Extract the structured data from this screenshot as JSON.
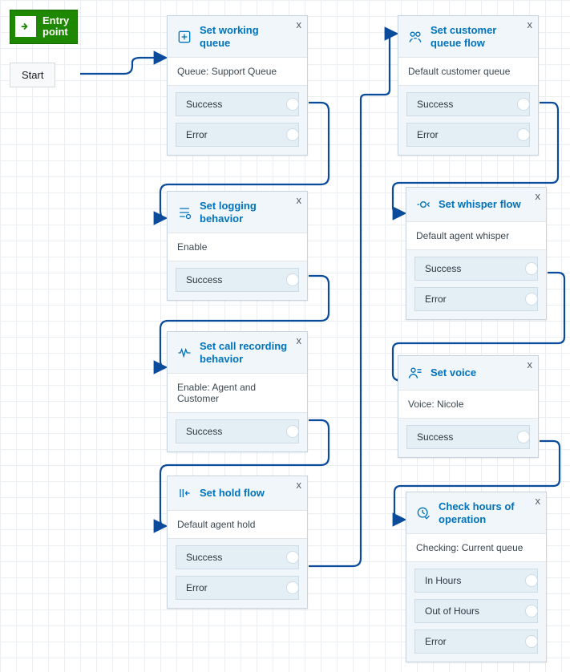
{
  "entry": {
    "title": "Entry\npoint",
    "start_label": "Start"
  },
  "close_label": "x",
  "blocks": {
    "working_queue": {
      "title": "Set working queue",
      "subtitle": "Queue: Support Queue",
      "outputs": [
        "Success",
        "Error"
      ]
    },
    "customer_queue": {
      "title": "Set customer queue flow",
      "subtitle": "Default customer queue",
      "outputs": [
        "Success",
        "Error"
      ]
    },
    "logging": {
      "title": "Set logging behavior",
      "subtitle": "Enable",
      "outputs": [
        "Success"
      ]
    },
    "whisper": {
      "title": "Set whisper flow",
      "subtitle": "Default agent whisper",
      "outputs": [
        "Success",
        "Error"
      ]
    },
    "recording": {
      "title": "Set call recording behavior",
      "subtitle": "Enable: Agent and Customer",
      "outputs": [
        "Success"
      ]
    },
    "voice": {
      "title": "Set voice",
      "subtitle": "Voice: Nicole",
      "outputs": [
        "Success"
      ]
    },
    "hold": {
      "title": "Set hold flow",
      "subtitle": "Default agent hold",
      "outputs": [
        "Success",
        "Error"
      ]
    },
    "hours": {
      "title": "Check hours of operation",
      "subtitle": "Checking: Current queue",
      "outputs": [
        "In Hours",
        "Out of Hours",
        "Error"
      ]
    }
  },
  "chart_data": {
    "type": "flow-diagram",
    "nodes": [
      {
        "id": "start",
        "label": "Entry point / Start",
        "kind": "entry"
      },
      {
        "id": "working_queue",
        "label": "Set working queue",
        "sub": "Queue: Support Queue",
        "outputs": [
          "Success",
          "Error"
        ]
      },
      {
        "id": "customer_queue",
        "label": "Set customer queue flow",
        "sub": "Default customer queue",
        "outputs": [
          "Success",
          "Error"
        ]
      },
      {
        "id": "logging",
        "label": "Set logging behavior",
        "sub": "Enable",
        "outputs": [
          "Success"
        ]
      },
      {
        "id": "whisper",
        "label": "Set whisper flow",
        "sub": "Default agent whisper",
        "outputs": [
          "Success",
          "Error"
        ]
      },
      {
        "id": "recording",
        "label": "Set call recording behavior",
        "sub": "Enable: Agent and Customer",
        "outputs": [
          "Success"
        ]
      },
      {
        "id": "voice",
        "label": "Set voice",
        "sub": "Voice: Nicole",
        "outputs": [
          "Success"
        ]
      },
      {
        "id": "hold",
        "label": "Set hold flow",
        "sub": "Default agent hold",
        "outputs": [
          "Success",
          "Error"
        ]
      },
      {
        "id": "hours",
        "label": "Check hours of operation",
        "sub": "Checking: Current queue",
        "outputs": [
          "In Hours",
          "Out of Hours",
          "Error"
        ]
      }
    ],
    "edges": [
      {
        "from": "start",
        "to": "working_queue"
      },
      {
        "from": "working_queue",
        "out": "Success",
        "to": "logging"
      },
      {
        "from": "logging",
        "out": "Success",
        "to": "recording"
      },
      {
        "from": "recording",
        "out": "Success",
        "to": "hold"
      },
      {
        "from": "hold",
        "out": "Success",
        "to": "customer_queue"
      },
      {
        "from": "customer_queue",
        "out": "Success",
        "to": "whisper"
      },
      {
        "from": "whisper",
        "out": "Success",
        "to": "voice"
      },
      {
        "from": "voice",
        "out": "Success",
        "to": "hours"
      }
    ]
  }
}
